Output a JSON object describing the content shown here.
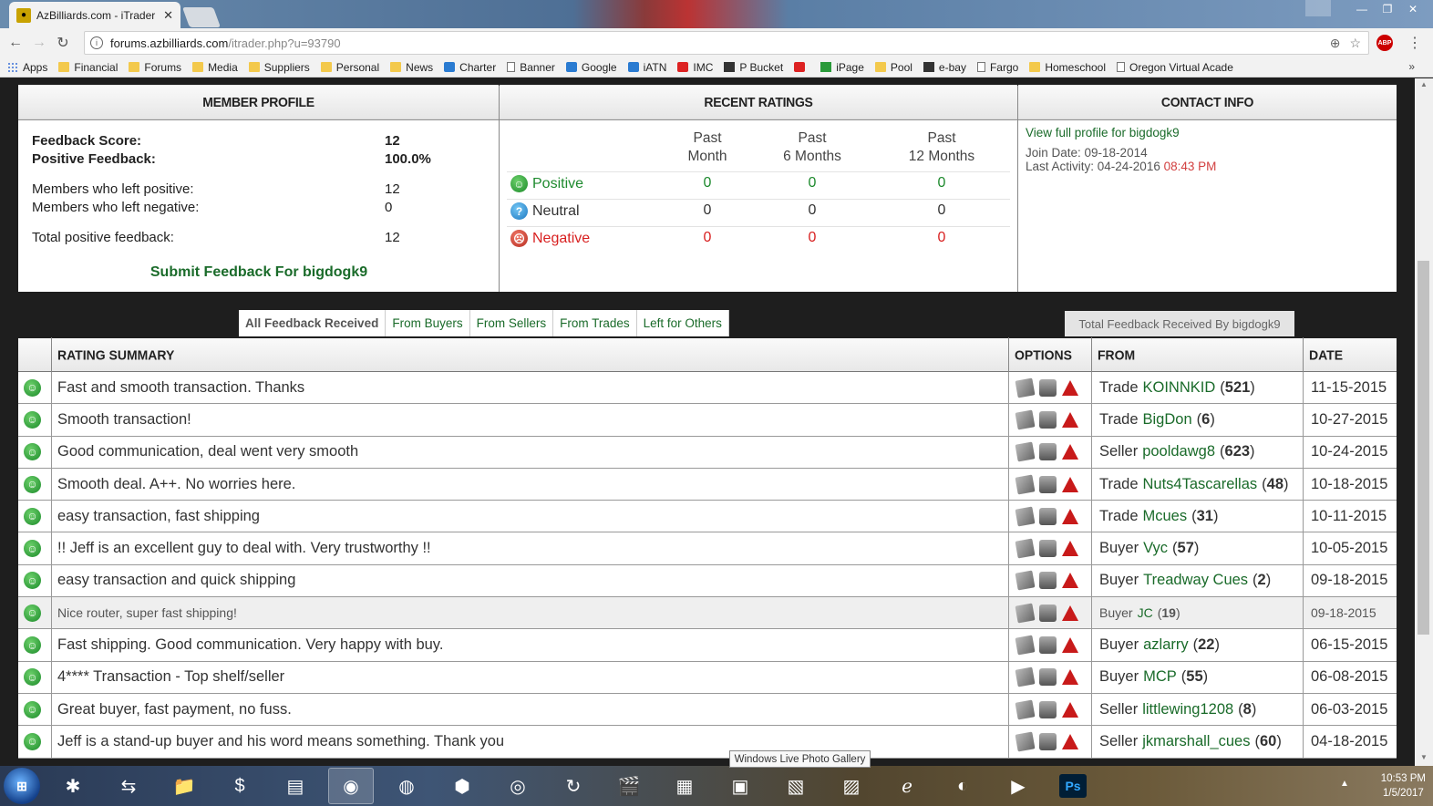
{
  "browser": {
    "tab_title": "AzBilliards.com - iTrader",
    "tab_close": "✕",
    "url_host": "forums.azbilliards.com",
    "url_path": "/itrader.php?u=93790",
    "abp_badge": "ABP",
    "bookmarks": [
      {
        "label": "Apps",
        "icon": "apps-icon"
      },
      {
        "label": "Financial",
        "icon": "folder-icon"
      },
      {
        "label": "Forums",
        "icon": "folder-icon"
      },
      {
        "label": "Media",
        "icon": "folder-icon"
      },
      {
        "label": "Suppliers",
        "icon": "folder-icon"
      },
      {
        "label": "Personal",
        "icon": "folder-icon"
      },
      {
        "label": "News",
        "icon": "folder-icon"
      },
      {
        "label": "Charter",
        "icon": "charter-icon"
      },
      {
        "label": "Banner",
        "icon": "page-icon"
      },
      {
        "label": "Google",
        "icon": "google-icon"
      },
      {
        "label": "iATN",
        "icon": "iatn-icon"
      },
      {
        "label": "IMC",
        "icon": "imc-icon"
      },
      {
        "label": "P Bucket",
        "icon": "camera-icon"
      },
      {
        "label": "",
        "icon": "youtube-icon"
      },
      {
        "label": "iPage",
        "icon": "ipage-icon"
      },
      {
        "label": "Pool",
        "icon": "folder-icon"
      },
      {
        "label": "e-bay",
        "icon": "ebay-icon"
      },
      {
        "label": "Fargo",
        "icon": "page-icon"
      },
      {
        "label": "Homeschool",
        "icon": "folder-icon"
      },
      {
        "label": "Oregon Virtual Acade",
        "icon": "oregon-icon"
      }
    ]
  },
  "profile": {
    "member_header": "MEMBER PROFILE",
    "ratings_header": "RECENT RATINGS",
    "contact_header": "CONTACT INFO",
    "feedback_score_label": "Feedback Score:",
    "feedback_score": "12",
    "positive_feedback_label": "Positive Feedback:",
    "positive_feedback": "100.0%",
    "left_positive_label": "Members who left positive:",
    "left_positive": "12",
    "left_negative_label": "Members who left negative:",
    "left_negative": "0",
    "total_positive_label": "Total positive feedback:",
    "total_positive": "12",
    "submit_link": "Submit Feedback For bigdogk9"
  },
  "ratings": {
    "col_month": [
      "Past",
      "Month"
    ],
    "col_6months": [
      "Past",
      "6 Months"
    ],
    "col_12months": [
      "Past",
      "12 Months"
    ],
    "positive_label": "Positive",
    "neutral_label": "Neutral",
    "negative_label": "Negative",
    "positive": [
      "0",
      "0",
      "0"
    ],
    "neutral": [
      "0",
      "0",
      "0"
    ],
    "negative": [
      "0",
      "0",
      "0"
    ]
  },
  "contact": {
    "profile_link": "View full profile for bigdogk9",
    "join_date": "Join Date: 09-18-2014",
    "last_activity": "Last Activity: 04-24-2016",
    "last_activity_time": "08:43 PM"
  },
  "feedback_tabs": {
    "all": "All Feedback Received",
    "buyers": "From Buyers",
    "sellers": "From Sellers",
    "trades": "From Trades",
    "others": "Left for Others",
    "total": "Total Feedback Received By bigdogk9"
  },
  "table": {
    "headers": {
      "summary": "RATING SUMMARY",
      "options": "OPTIONS",
      "from": "FROM",
      "date": "DATE"
    },
    "rows": [
      {
        "summary": "Fast and smooth transaction. Thanks",
        "role": "Trade",
        "name": "KOINNKID",
        "count": "521",
        "date": "11-15-2015"
      },
      {
        "summary": "Smooth transaction!",
        "role": "Trade",
        "name": "BigDon",
        "count": "6",
        "date": "10-27-2015"
      },
      {
        "summary": "Good communication, deal went very smooth",
        "role": "Seller",
        "name": "pooldawg8",
        "count": "623",
        "date": "10-24-2015"
      },
      {
        "summary": "Smooth deal. A++. No worries here.",
        "role": "Trade",
        "name": "Nuts4Tascarellas",
        "count": "48",
        "date": "10-18-2015"
      },
      {
        "summary": "easy transaction, fast shipping",
        "role": "Trade",
        "name": "Mcues",
        "count": "31",
        "date": "10-11-2015"
      },
      {
        "summary": "!! Jeff is an excellent guy to deal with. Very trustworthy !!",
        "role": "Buyer",
        "name": "Vyc",
        "count": "57",
        "date": "10-05-2015"
      },
      {
        "summary": "easy transaction and quick shipping",
        "role": "Buyer",
        "name": "Treadway Cues",
        "count": "2",
        "date": "09-18-2015"
      },
      {
        "summary": "Nice router, super fast shipping!",
        "role": "Buyer",
        "name": "JC",
        "count": "19",
        "date": "09-18-2015"
      },
      {
        "summary": "Fast shipping. Good communication. Very happy with buy.",
        "role": "Buyer",
        "name": "azlarry",
        "count": "22",
        "date": "06-15-2015"
      },
      {
        "summary": "4**** Transaction - Top shelf/seller",
        "role": "Buyer",
        "name": "MCP",
        "count": "55",
        "date": "06-08-2015"
      },
      {
        "summary": "Great buyer, fast payment, no fuss.",
        "role": "Seller",
        "name": "littlewing1208",
        "count": "8",
        "date": "06-03-2015"
      },
      {
        "summary": "Jeff is a stand-up buyer and his word means something. Thank you",
        "role": "Seller",
        "name": "jkmarshall_cues",
        "count": "60",
        "date": "04-18-2015"
      }
    ]
  },
  "tooltip": "Windows Live Photo Gallery",
  "taskbar": {
    "time": "10:53 PM",
    "date": "1/5/2017",
    "ps_label": "Ps"
  }
}
